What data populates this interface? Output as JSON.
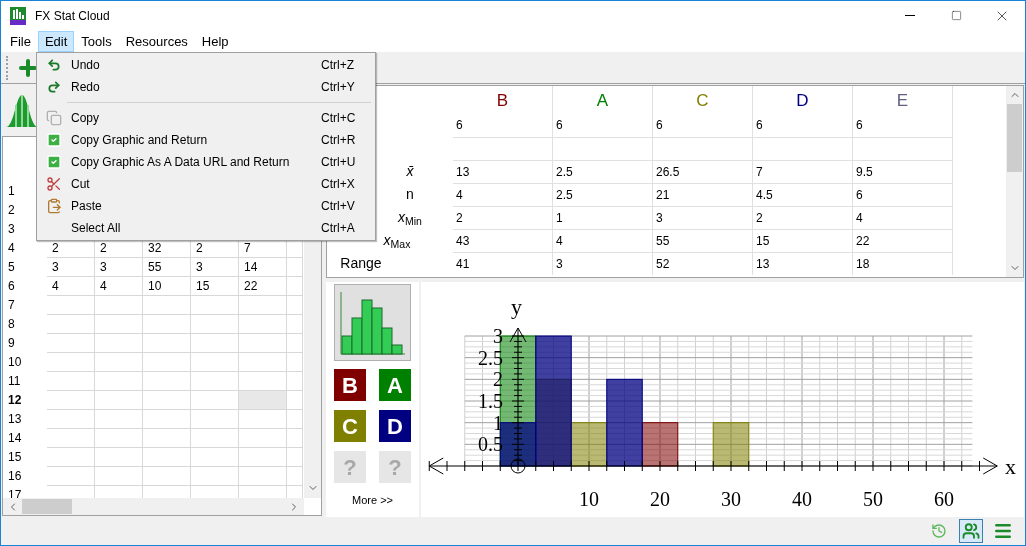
{
  "window": {
    "title": "FX Stat Cloud"
  },
  "menu_bar": [
    {
      "label": "File",
      "selected": false
    },
    {
      "label": "Edit",
      "selected": true
    },
    {
      "label": "Tools",
      "selected": false
    },
    {
      "label": "Resources",
      "selected": false
    },
    {
      "label": "Help",
      "selected": false
    }
  ],
  "edit_menu": [
    {
      "kind": "command",
      "label": "Undo",
      "shortcut": "Ctrl+Z"
    },
    {
      "kind": "command",
      "label": "Redo",
      "shortcut": "Ctrl+Y"
    },
    {
      "kind": "separator"
    },
    {
      "kind": "command",
      "label": "Copy",
      "shortcut": "Ctrl+C"
    },
    {
      "kind": "command",
      "label": "Copy Graphic and Return",
      "shortcut": "Ctrl+R"
    },
    {
      "kind": "command",
      "label": "Copy Graphic As A Data URL and Return",
      "shortcut": "Ctrl+U"
    },
    {
      "kind": "command",
      "label": "Cut",
      "shortcut": "Ctrl+X"
    },
    {
      "kind": "command",
      "label": "Paste",
      "shortcut": "Ctrl+V"
    },
    {
      "kind": "command",
      "label": "Select All",
      "shortcut": "Ctrl+A"
    }
  ],
  "grid": {
    "rows": [
      {
        "number": "1",
        "selected": false
      },
      {
        "number": "2",
        "selected": false
      },
      {
        "number": "3",
        "selected": false
      },
      {
        "number": "4",
        "selected": false,
        "values": [
          "2",
          "2",
          "32",
          "2",
          "7"
        ]
      },
      {
        "number": "5",
        "selected": false,
        "values": [
          "3",
          "3",
          "55",
          "3",
          "14"
        ]
      },
      {
        "number": "6",
        "selected": false,
        "values": [
          "4",
          "4",
          "10",
          "15",
          "22"
        ]
      },
      {
        "number": "7",
        "selected": false
      },
      {
        "number": "8",
        "selected": false
      },
      {
        "number": "9",
        "selected": false
      },
      {
        "number": "10",
        "selected": false
      },
      {
        "number": "11",
        "selected": false
      },
      {
        "number": "12",
        "selected": true
      },
      {
        "number": "13",
        "selected": false
      },
      {
        "number": "14",
        "selected": false
      },
      {
        "number": "15",
        "selected": false
      },
      {
        "number": "16",
        "selected": false
      },
      {
        "number": "17",
        "selected": false
      }
    ]
  },
  "stats": {
    "columns": [
      {
        "label": "B",
        "color": "#800000"
      },
      {
        "label": "A",
        "color": "#008000"
      },
      {
        "label": "C",
        "color": "#808000"
      },
      {
        "label": "D",
        "color": "#000080"
      },
      {
        "label": "E",
        "color": "#606080"
      }
    ],
    "rows": [
      {
        "kind": "data",
        "values": [
          "6",
          "6",
          "6",
          "6",
          "6"
        ]
      },
      {
        "kind": "blank"
      },
      {
        "kind": "data",
        "label": "*x̄*",
        "values": [
          "13",
          "2.5",
          "26.5",
          "7",
          "9.5"
        ]
      },
      {
        "kind": "data",
        "label": "n",
        "values": [
          "4",
          "2.5",
          "21",
          "4.5",
          "6"
        ]
      },
      {
        "kind": "data",
        "label": "*x*$_{Min}$",
        "values": [
          "2",
          "1",
          "3",
          "2",
          "4"
        ]
      },
      {
        "kind": "data",
        "label": "*x*$_{Max}$",
        "values": [
          "43",
          "4",
          "55",
          "15",
          "22"
        ]
      },
      {
        "kind": "data",
        "label": "Range",
        "values": [
          "41",
          "3",
          "52",
          "13",
          "18"
        ]
      }
    ]
  },
  "chart_panel": {
    "series_buttons": [
      {
        "label": "B",
        "color": "#800000",
        "disabled": false
      },
      {
        "label": "A",
        "color": "#008000",
        "disabled": false
      },
      {
        "label": "C",
        "color": "#808000",
        "disabled": false
      },
      {
        "label": "D",
        "color": "#000080",
        "disabled": false
      },
      {
        "label": "?",
        "color": "#e6e6e6",
        "disabled": true
      },
      {
        "label": "?",
        "color": "#e6e6e6",
        "disabled": true
      }
    ],
    "more_link": "More >>"
  },
  "chart_data": {
    "type": "bar",
    "x": [
      0,
      5,
      10,
      15,
      20,
      30
    ],
    "series": [
      {
        "color": "#008000",
        "values": [
          3,
          0,
          0,
          0,
          0,
          0
        ]
      },
      {
        "color": "#808000",
        "values": [
          0,
          2,
          1,
          0,
          0,
          1
        ]
      },
      {
        "color": "#800000",
        "values": [
          0,
          0,
          0,
          0,
          1,
          0
        ]
      },
      {
        "color": "#000080",
        "values": [
          1,
          3,
          0,
          2,
          0,
          0
        ]
      }
    ],
    "xlim": [
      -12.5,
      67.5
    ],
    "ylim": [
      0,
      3
    ],
    "xticks": [
      10,
      20,
      30,
      40,
      50,
      60
    ],
    "yticks": [
      0.5,
      1,
      1.5,
      2,
      2.5,
      3
    ],
    "stacked": false,
    "grid": true,
    "ref_lines": [
      {
        "axis": "x",
        "value": 0
      }
    ],
    "annotations": [
      "x",
      "y"
    ]
  },
  "status_bar": {
    "buttons": [
      {
        "selected": false
      },
      {
        "selected": true
      },
      {
        "selected": false
      }
    ]
  }
}
